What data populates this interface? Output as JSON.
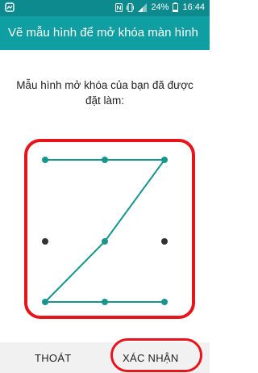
{
  "status_bar": {
    "time": "16:44",
    "battery": "24%",
    "icons": [
      "notification-icon",
      "nfc-icon",
      "vibrate-icon",
      "signal-icon",
      "battery-icon"
    ]
  },
  "title_bar": {
    "title": "Vẽ mẫu hình để mở khóa màn hình"
  },
  "instruction": "Mẫu hình mở khóa của bạn đã được đặt làm:",
  "pattern": {
    "grid": [
      3,
      3
    ],
    "sequence": [
      1,
      2,
      3,
      5,
      7,
      8,
      9
    ],
    "colors": {
      "line": "#16968c",
      "active_dot": "#16968c",
      "inactive_dot": "#333333",
      "highlight": "#e8141c"
    }
  },
  "actions": {
    "exit_label": "THOÁT",
    "confirm_label": "XÁC NHẬN"
  },
  "colors": {
    "status_bar": "#0d8a8e",
    "title_bar": "#0f9ea2",
    "bottom_bar": "#f1f1f1"
  }
}
